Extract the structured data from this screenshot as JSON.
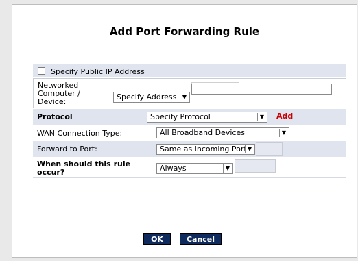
{
  "dialog": {
    "title": "Add Port Forwarding Rule"
  },
  "public_ip": {
    "checkbox_label": "Specify Public IP Address",
    "checked": false
  },
  "networked_device": {
    "label_line1": "Networked",
    "label_line2": "Computer /",
    "label_line3": "Device:",
    "select_value": "Specify Address",
    "text_value": ""
  },
  "protocol": {
    "label": "Protocol",
    "select_value": "Specify Protocol",
    "add_link": "Add"
  },
  "wan": {
    "label": "WAN Connection Type:",
    "select_value": "All Broadband Devices"
  },
  "forward": {
    "label": "Forward to Port:",
    "select_value": "Same as Incoming Port"
  },
  "schedule": {
    "label_line1": "When should this rule",
    "label_line2": "occur?",
    "select_value": "Always"
  },
  "buttons": {
    "ok": "OK",
    "cancel": "Cancel"
  },
  "icons": {
    "dropdown_arrow": "chevron-down-icon"
  }
}
